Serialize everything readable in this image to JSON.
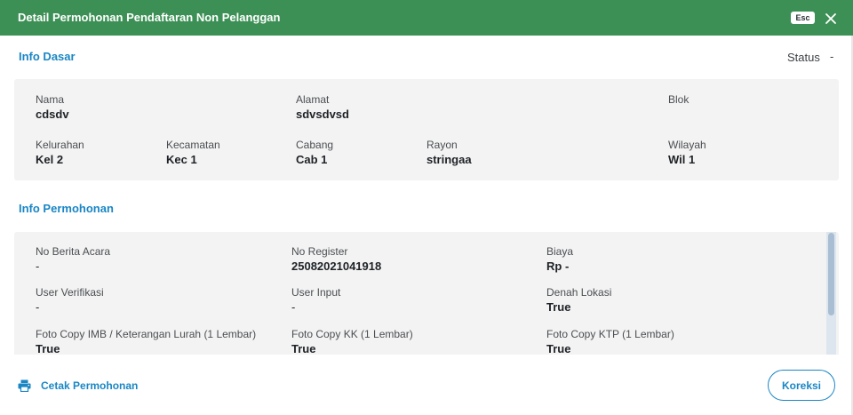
{
  "header": {
    "title": "Detail Permohonan Pendaftaran Non Pelanggan",
    "esc_label": "Esc",
    "close_icon": "close-icon",
    "bg_color": "#3d9055"
  },
  "info_dasar": {
    "title": "Info Dasar",
    "status_label": "Status",
    "status_value": "-",
    "fields": {
      "nama": {
        "label": "Nama",
        "value": "cdsdv"
      },
      "alamat": {
        "label": "Alamat",
        "value": "sdvsdvsd"
      },
      "blok": {
        "label": "Blok",
        "value": ""
      },
      "kelurahan": {
        "label": "Kelurahan",
        "value": "Kel 2"
      },
      "kecamatan": {
        "label": "Kecamatan",
        "value": "Kec 1"
      },
      "cabang": {
        "label": "Cabang",
        "value": "Cab 1"
      },
      "rayon": {
        "label": "Rayon",
        "value": "stringaa"
      },
      "wilayah": {
        "label": "Wilayah",
        "value": "Wil 1"
      }
    }
  },
  "info_permohonan": {
    "title": "Info Permohonan",
    "fields": {
      "no_berita_acara": {
        "label": "No Berita Acara",
        "value": "-"
      },
      "no_register": {
        "label": "No Register",
        "value": "25082021041918"
      },
      "biaya": {
        "label": "Biaya",
        "value": "Rp -"
      },
      "user_verifikasi": {
        "label": "User Verifikasi",
        "value": "-"
      },
      "user_input": {
        "label": "User Input",
        "value": "-"
      },
      "denah_lokasi": {
        "label": "Denah Lokasi",
        "value": "True"
      },
      "foto_imb": {
        "label": "Foto Copy IMB / Keterangan Lurah (1 Lembar)",
        "value": "True"
      },
      "foto_kk": {
        "label": "Foto Copy KK (1 Lembar)",
        "value": "True"
      },
      "foto_ktp": {
        "label": "Foto Copy KTP (1 Lembar)",
        "value": "True"
      }
    }
  },
  "footer": {
    "print_label": "Cetak Permohonan",
    "print_icon": "printer-icon",
    "koreksi_label": "Koreksi",
    "accent_color": "#1a86c4"
  }
}
